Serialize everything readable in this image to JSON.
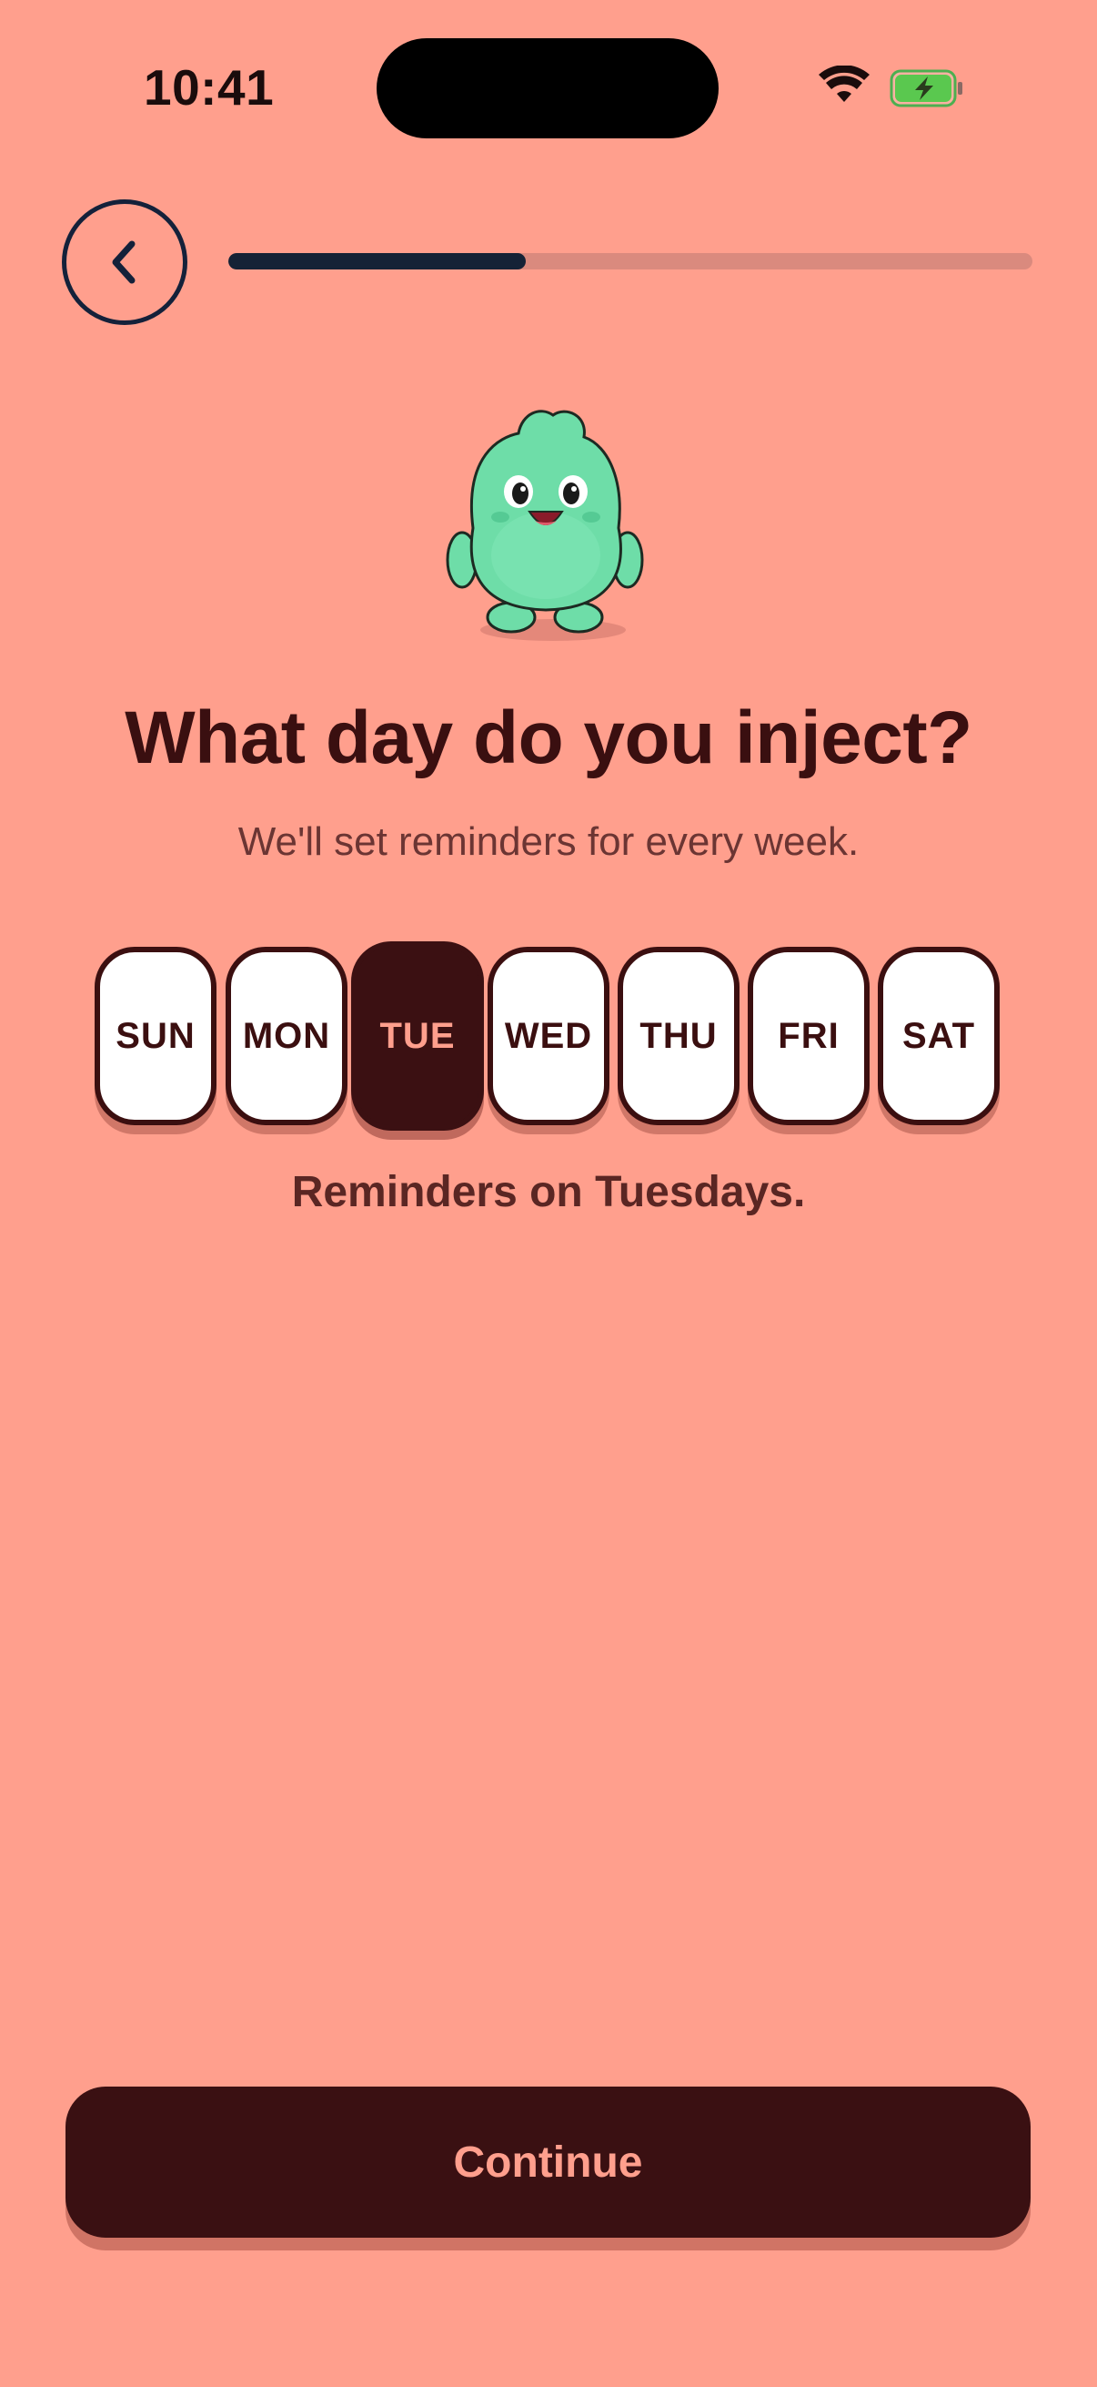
{
  "status_bar": {
    "time": "10:41"
  },
  "header": {
    "back_icon": "chevron-left-icon",
    "progress_percent": 37
  },
  "mascot": {
    "icon": "green-monster-mascot"
  },
  "main": {
    "title": "What day do you inject?",
    "subtitle": "We'll set reminders for every week.",
    "days": [
      {
        "label": "SUN",
        "selected": false
      },
      {
        "label": "MON",
        "selected": false
      },
      {
        "label": "TUE",
        "selected": true
      },
      {
        "label": "WED",
        "selected": false
      },
      {
        "label": "THU",
        "selected": false
      },
      {
        "label": "FRI",
        "selected": false
      },
      {
        "label": "SAT",
        "selected": false
      }
    ],
    "reminder_text": "Reminders on Tuesdays."
  },
  "footer": {
    "continue_label": "Continue"
  },
  "colors": {
    "background": "#FF9F8D",
    "dark_brown": "#3B1012",
    "progress_fill": "#152236",
    "mascot_green": "#6EDDA8"
  }
}
